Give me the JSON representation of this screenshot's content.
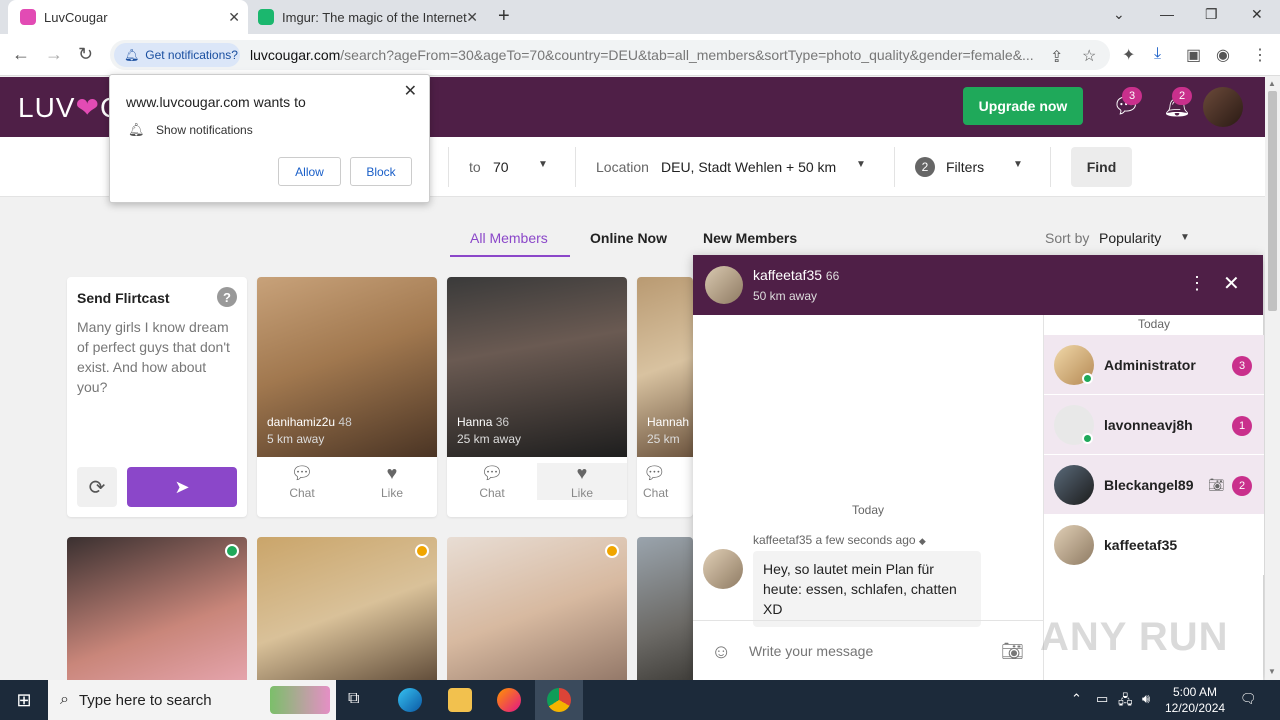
{
  "browser": {
    "tabs": [
      {
        "title": "LuvCougar",
        "active": true
      },
      {
        "title": "Imgur: The magic of the Internet",
        "active": false
      }
    ],
    "notif_chip": "Get notifications?",
    "url_host": "luvcougar.com",
    "url_rest": "/search?ageFrom=30&ageTo=70&country=DEU&tab=all_members&sortType=photo_quality&gender=female&..."
  },
  "notification_prompt": {
    "title": "www.luvcougar.com wants to",
    "permission": "Show notifications",
    "allow": "Allow",
    "block": "Block"
  },
  "site": {
    "logo_left": "LUV",
    "logo_right": "C",
    "upgrade": "Upgrade now",
    "messages_count": "3",
    "notifications_count": "2"
  },
  "filters": {
    "to_label": "to",
    "to_value": "70",
    "location_label": "Location",
    "location_value": "DEU, Stadt Wehlen + 50 km",
    "filters_count": "2",
    "filters_label": "Filters",
    "find": "Find"
  },
  "member_tabs": [
    "All Members",
    "Online Now",
    "New Members"
  ],
  "sort": {
    "label": "Sort by",
    "value": "Popularity"
  },
  "flirtcast": {
    "title": "Send Flirtcast",
    "help": "?",
    "text": "Many girls I know dream of perfect guys that don't exist. And how about you?"
  },
  "cards": [
    {
      "name": "danihamiz2u",
      "age": "48",
      "distance": "5 km away",
      "chat": "Chat",
      "like": "Like"
    },
    {
      "name": "Hanna",
      "age": "36",
      "distance": "25 km away",
      "chat": "Chat",
      "like": "Like"
    },
    {
      "name": "Hannah",
      "age": "",
      "distance": "25 km",
      "chat": "Chat",
      "like": ""
    }
  ],
  "chat": {
    "name": "kaffeetaf35",
    "age": "66",
    "distance": "50 km away",
    "day": "Today",
    "sender_line": "kaffeetaf35 a few seconds ago",
    "message": "Hey, so lautet mein Plan für heute: essen, schlafen, chatten XD",
    "input_placeholder": "Write your message",
    "list_day": "Today",
    "conversations": [
      {
        "name": "Administrator",
        "badge": "3"
      },
      {
        "name": "lavonneavj8h",
        "badge": "1"
      },
      {
        "name": "Bleckangel89",
        "badge": "2"
      },
      {
        "name": "kaffeetaf35",
        "badge": ""
      }
    ]
  },
  "watermark": "ANY RUN",
  "taskbar": {
    "search_placeholder": "Type here to search",
    "time": "5:00 AM",
    "date": "12/20/2024"
  },
  "colors": {
    "brand_purple": "#4f1f47",
    "accent_violet": "#8b47c9",
    "upgrade_green": "#1fa95a",
    "badge_pink": "#c9308c"
  }
}
